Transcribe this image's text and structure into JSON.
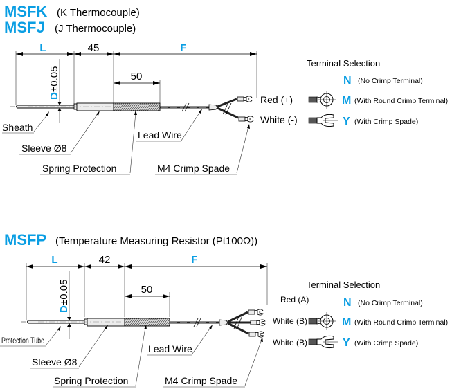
{
  "sections": [
    {
      "titles": [
        {
          "code": "MSFK",
          "desc": "(K Thermocouple)"
        },
        {
          "code": "MSFJ",
          "desc": "(J Thermocouple)"
        }
      ],
      "dimensions": {
        "L": "L",
        "sleeve_len": "45",
        "F": "F",
        "spring_len": "50",
        "diameter": "D",
        "tolerance": "±0.05"
      },
      "labels": {
        "tip": "Sheath",
        "sleeve": "Sleeve Ø8",
        "spring": "Spring Protection",
        "lead": "Lead Wire",
        "crimp": "M4 Crimp Spade"
      },
      "wires": [
        "Red (+)",
        "White (-)"
      ],
      "terminal_selection": {
        "heading": "Terminal Selection",
        "options": [
          {
            "code": "N",
            "desc": "(No Crimp Terminal)",
            "icon": "none"
          },
          {
            "code": "M",
            "desc": "(With Round Crimp Terminal)",
            "icon": "round-crimp-terminal-icon"
          },
          {
            "code": "Y",
            "desc": "(With Crimp Spade)",
            "icon": "crimp-spade-icon"
          }
        ]
      }
    },
    {
      "titles": [
        {
          "code": "MSFP",
          "desc": "(Temperature Measuring Resistor (Pt100Ω))"
        }
      ],
      "dimensions": {
        "L": "L",
        "sleeve_len": "42",
        "F": "F",
        "spring_len": "50",
        "diameter": "D",
        "tolerance": "±0.05"
      },
      "labels": {
        "tip": "Protection Tube",
        "sleeve": "Sleeve Ø8",
        "spring": "Spring Protection",
        "lead": "Lead Wire",
        "crimp": "M4 Crimp Spade"
      },
      "wires": [
        "Red (A)",
        "White (B)",
        "White (B)"
      ],
      "terminal_selection": {
        "heading": "Terminal Selection",
        "options": [
          {
            "code": "N",
            "desc": "(No Crimp Terminal)",
            "icon": "none"
          },
          {
            "code": "M",
            "desc": "(With Round Crimp Terminal)",
            "icon": "round-crimp-terminal-icon"
          },
          {
            "code": "Y",
            "desc": "(With Crimp Spade)",
            "icon": "crimp-spade-icon"
          }
        ]
      }
    }
  ],
  "colors": {
    "accent": "#0a9ee3",
    "line": "#000000"
  }
}
